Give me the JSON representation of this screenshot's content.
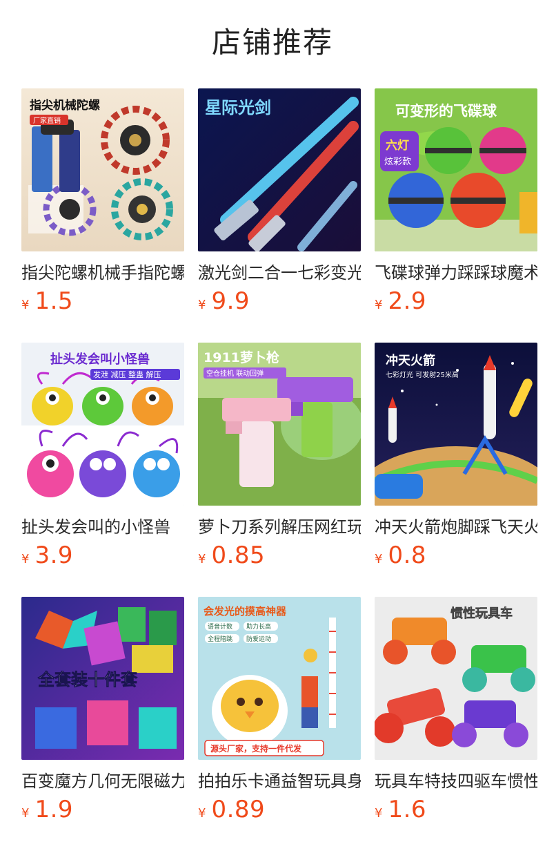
{
  "header": {
    "title": "店铺推荐"
  },
  "products": [
    {
      "title": "指尖陀螺机械手指陀螺",
      "currency": "¥",
      "price": "1.5",
      "image_text": {
        "headline": "指尖机械陀螺",
        "tag": "厂家直销"
      }
    },
    {
      "title": "激光剑二合一七彩变光",
      "currency": "¥",
      "price": "9.9",
      "image_text": {
        "headline": "星际光剑"
      }
    },
    {
      "title": "飞碟球弹力踩踩球魔术",
      "currency": "¥",
      "price": "2.9",
      "image_text": {
        "headline": "可变形的飞碟球",
        "badge_line1": "六灯",
        "badge_line2": "炫彩款"
      }
    },
    {
      "title": "扯头发会叫的小怪兽",
      "currency": "¥",
      "price": "3.9",
      "image_text": {
        "headline": "扯头发会叫小怪兽",
        "subline": "发泄 减压 整蛊 解压"
      }
    },
    {
      "title": "萝卜刀系列解压网红玩具",
      "currency": "¥",
      "price": "0.85",
      "image_text": {
        "headline": "1911萝卜枪",
        "subline": "空仓挂机 联动回弹"
      }
    },
    {
      "title": "冲天火箭炮脚踩飞天火箭",
      "currency": "¥",
      "price": "0.8",
      "image_text": {
        "headline": "冲天火箭",
        "subline": "七彩灯光 可发射25米高"
      }
    },
    {
      "title": "百变魔方几何无限磁力",
      "currency": "¥",
      "price": "1.9",
      "image_text": {
        "headline": "全套装十件套"
      }
    },
    {
      "title": "拍拍乐卡通益智玩具身高",
      "currency": "¥",
      "price": "0.89",
      "image_text": {
        "headline": "会发光的摸高神器",
        "tags": [
          "语音计数",
          "助力长高",
          "全程陪跳",
          "防爱运动"
        ],
        "footer": "源头厂家，支持一件代发"
      }
    },
    {
      "title": "玩具车特技四驱车惯性车",
      "currency": "¥",
      "price": "1.6",
      "image_text": {
        "headline": "惯性玩具车"
      }
    }
  ]
}
